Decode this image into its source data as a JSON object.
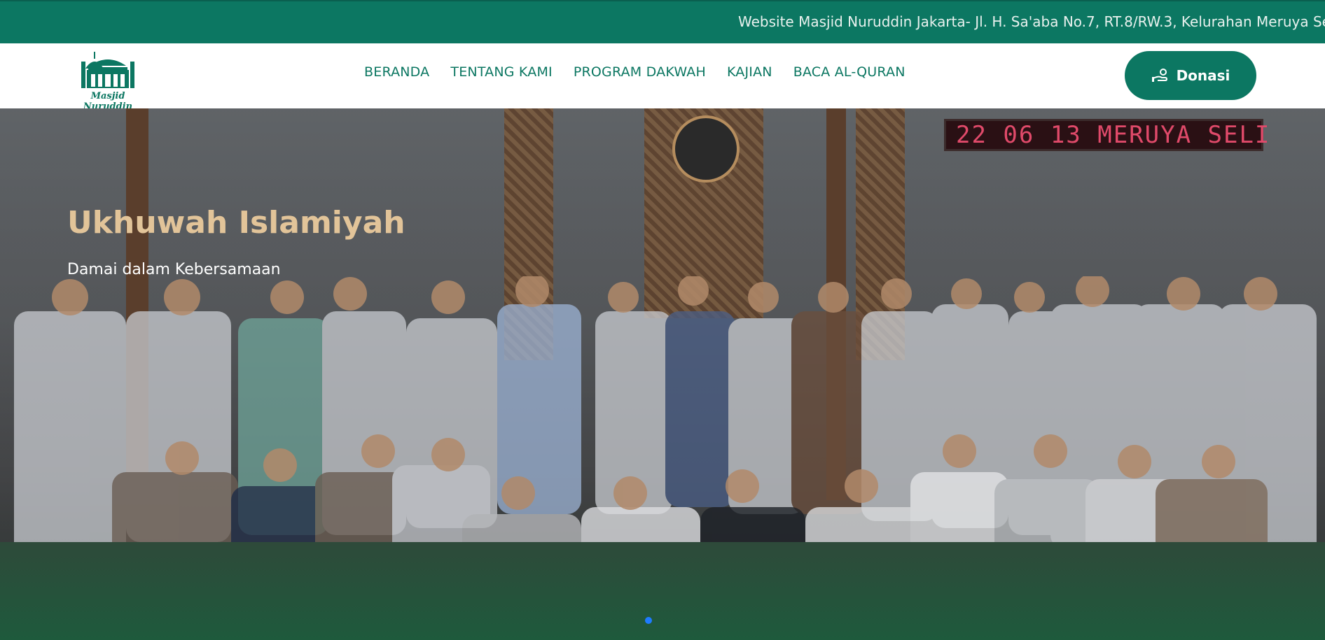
{
  "topbar": {
    "announcement": "Website Masjid Nuruddin Jakarta- Jl. H. Sa'aba No.7, RT.8/RW.3, Kelurahan Meruya Se"
  },
  "header": {
    "logo_text": "Masjid Nuruddin",
    "nav": [
      "BERANDA",
      "TENTANG KAMI",
      "PROGRAM DAKWAH",
      "KAJIAN",
      "BACA AL-QURAN"
    ],
    "donate_label": "Donasi",
    "donate_icon": "hand-coin-icon"
  },
  "hero": {
    "title": "Ukhuwah Islamiyah",
    "subtitle": "Damai dalam Kebersamaan",
    "led_sign": "22 06 13 MERUYA SELI",
    "slide_count": 1,
    "active_slide": 1
  },
  "colors": {
    "primary": "#0c7762",
    "title_gold": "#e2c499",
    "carousel_dot": "#1e7bff"
  }
}
